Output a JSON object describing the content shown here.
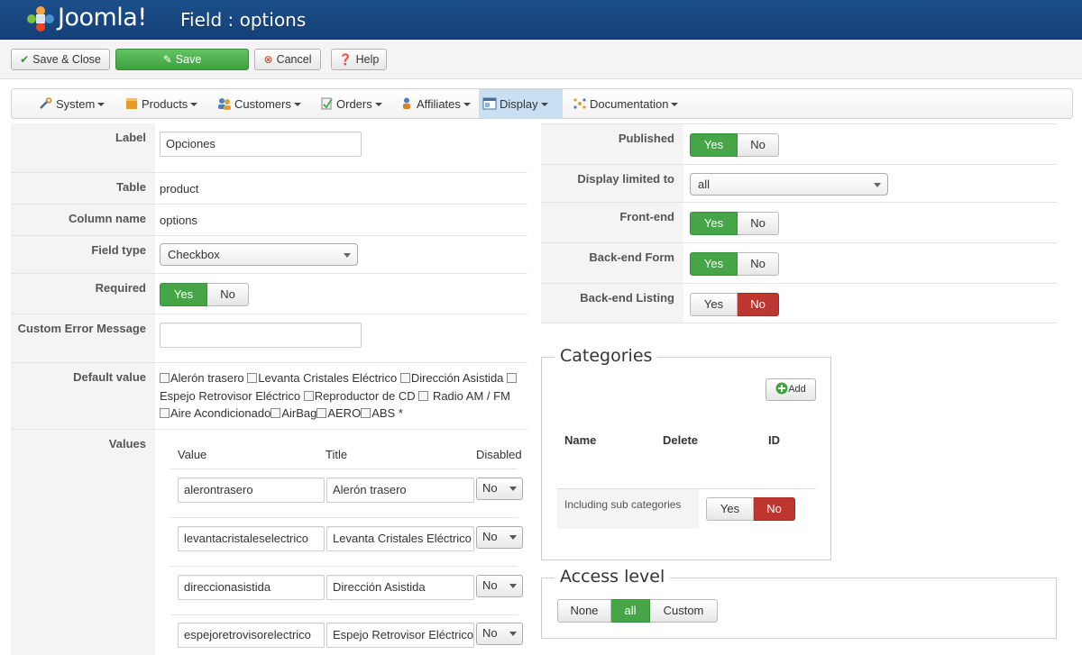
{
  "header": {
    "logo_text": "Joomla!",
    "title": "Field : options"
  },
  "toolbar": {
    "save_close": "Save & Close",
    "save": "Save",
    "cancel": "Cancel",
    "help": "Help"
  },
  "menu": {
    "items": [
      "System",
      "Products",
      "Customers",
      "Orders",
      "Affiliates",
      "Display",
      "Documentation"
    ],
    "active": "Display"
  },
  "left_form": {
    "label": {
      "label": "Label",
      "value": "Opciones"
    },
    "table": {
      "label": "Table",
      "value": "product"
    },
    "column_name": {
      "label": "Column name",
      "value": "options"
    },
    "field_type": {
      "label": "Field type",
      "value": "Checkbox"
    },
    "required": {
      "label": "Required",
      "yes": "Yes",
      "no": "No",
      "selected": "Yes"
    },
    "custom_error": {
      "label": "Custom Error Message",
      "value": ""
    },
    "default_value": {
      "label": "Default value",
      "options": [
        "Alerón trasero",
        "Levanta Cristales Eléctrico",
        "Dirección Asistida",
        "Espejo Retrovisor Eléctrico",
        "Reproductor de CD",
        "Radio AM / FM",
        "Aire Acondicionado",
        "AirBag",
        "AERO",
        "ABS"
      ],
      "required_marker": "*"
    },
    "values": {
      "label": "Values",
      "headers": {
        "value": "Value",
        "title": "Title",
        "disabled": "Disabled"
      },
      "rows": [
        {
          "value": "alerontrasero",
          "title": "Alerón trasero",
          "disabled": "No"
        },
        {
          "value": "levantacristaleselectrico",
          "title": "Levanta Cristales Eléctrico",
          "disabled": "No"
        },
        {
          "value": "direccionasistida",
          "title": "Dirección Asistida",
          "disabled": "No"
        },
        {
          "value": "espejoretrovisorelectrico",
          "title": "Espejo Retrovisor Eléctrico",
          "disabled": "No"
        }
      ]
    }
  },
  "right_form": {
    "published": {
      "label": "Published",
      "yes": "Yes",
      "no": "No",
      "selected": "Yes"
    },
    "display_limited": {
      "label": "Display limited to",
      "value": "all"
    },
    "front_end": {
      "label": "Front-end",
      "yes": "Yes",
      "no": "No",
      "selected": "Yes"
    },
    "backend_form": {
      "label": "Back-end Form",
      "yes": "Yes",
      "no": "No",
      "selected": "Yes"
    },
    "backend_listing": {
      "label": "Back-end Listing",
      "yes": "Yes",
      "no": "No",
      "selected": "No"
    }
  },
  "categories": {
    "legend": "Categories",
    "add": "Add",
    "col_name": "Name",
    "col_delete": "Delete",
    "col_id": "ID",
    "sub_label": "Including sub categories",
    "sub_yes": "Yes",
    "sub_no": "No",
    "sub_selected": "No"
  },
  "access": {
    "legend": "Access level",
    "options": [
      "None",
      "all",
      "Custom"
    ],
    "selected": "all"
  },
  "colors": {
    "header_blue": "#1b4f8a",
    "yes_green": "#46a546",
    "no_red": "#bd362f",
    "active_menu": "#c9e0f3"
  }
}
